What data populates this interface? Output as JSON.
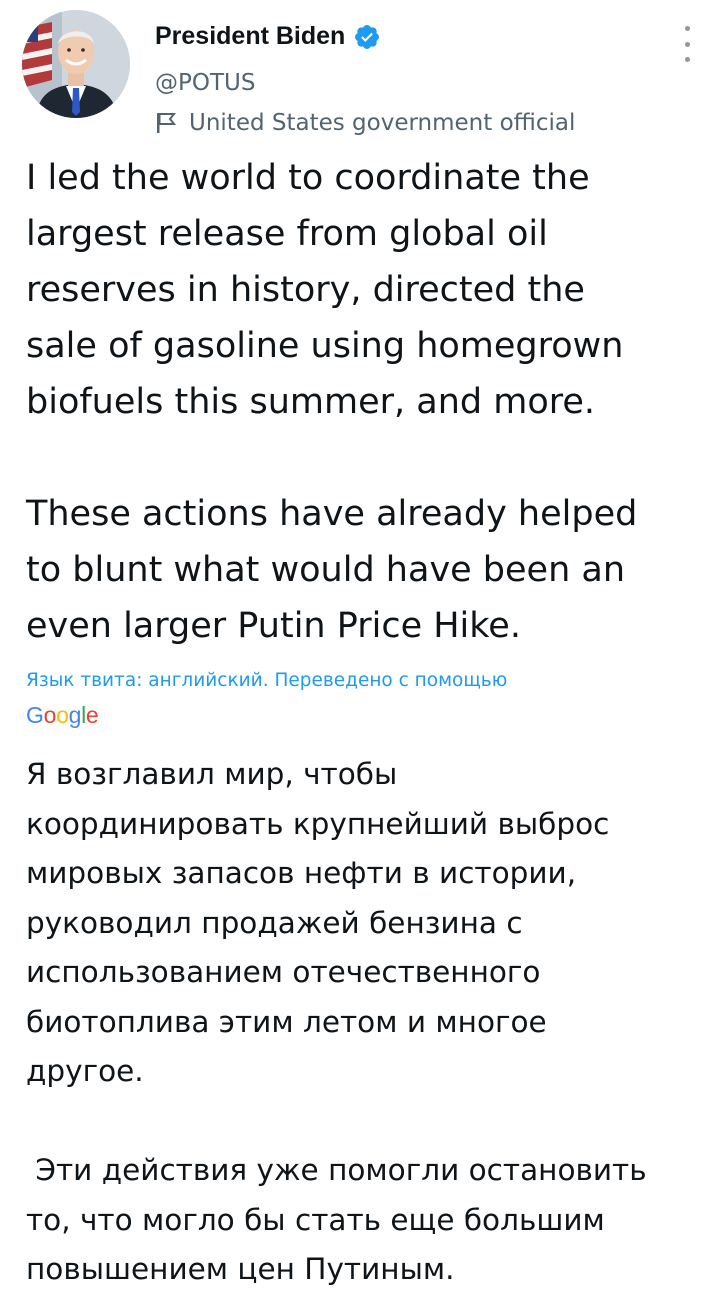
{
  "tweet": {
    "author": {
      "display_name": "President Biden",
      "handle": "@POTUS",
      "account_label": "United States government official",
      "verified_color": "#1d9bf0",
      "avatar_icon": "avatar-photo",
      "label_icon": "flag-icon",
      "menu_icon": "more-vertical-icon"
    },
    "text": "I led the world to coordinate the\nlargest release from global oil\nreserves in history, directed the\nsale of gasoline using homegrown\nbiofuels this summer, and more.\n\nThese actions have already helped\nto blunt what would have been an\neven larger Putin Price Hike.",
    "translation": {
      "label": "Язык твита: английский. Переведено с помощью",
      "provider": "Google",
      "provider_colors": [
        "#4285f4",
        "#ea4335",
        "#fbbc05",
        "#4285f4",
        "#34a853",
        "#ea4335"
      ],
      "text": "Я возглавил мир, чтобы\nкоординировать крупнейший выброс\nмировых запасов нефти в истории,\nруководил продажей бензина с\nиспользованием отечественного\nбиотоплива этим летом и многое\nдругое.\n\n Эти действия уже помогли остановить\nто, что могло бы стать еще большим\nповышением цен Путиным."
    }
  }
}
